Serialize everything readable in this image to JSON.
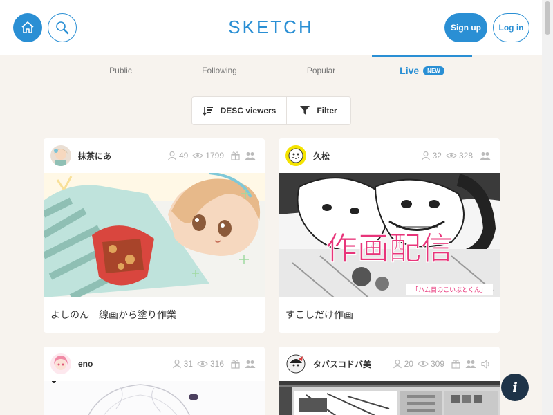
{
  "header": {
    "logo": "SKETCH",
    "signup_label": "Sign up",
    "login_label": "Log in",
    "home_icon": "home-icon",
    "search_icon": "search-icon"
  },
  "tabs": [
    {
      "label": "Public"
    },
    {
      "label": "Following"
    },
    {
      "label": "Popular"
    },
    {
      "label": "Live",
      "badge": "NEW",
      "active": true
    }
  ],
  "sort": {
    "sort_label": "DESC viewers",
    "filter_label": "Filter"
  },
  "cards": [
    {
      "user": "抹茶にあ",
      "viewers": "49",
      "views": "1799",
      "title": "よしのん　線画から塗り作業"
    },
    {
      "user": "久松",
      "viewers": "32",
      "views": "328",
      "title": "すこしだけ作画",
      "image_text": "作画配信",
      "image_subtext": "「ハム目のこいぶとくん」"
    },
    {
      "user": "eno",
      "viewers": "31",
      "views": "316",
      "title": ""
    },
    {
      "user": "タバスコドバ美",
      "viewers": "20",
      "views": "309",
      "title": ""
    }
  ],
  "info_label": "i",
  "colors": {
    "accent": "#2a8fd4",
    "background": "#f7f3ee",
    "info_button": "#1e3348"
  }
}
